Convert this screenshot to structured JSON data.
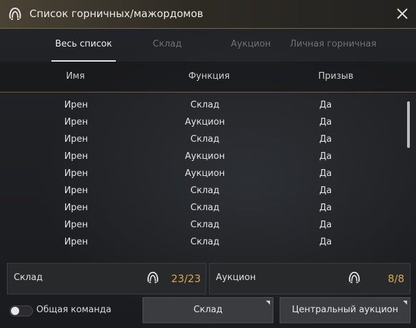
{
  "window": {
    "title": "Список горничных/мажордомов"
  },
  "tabs": [
    {
      "label": "Весь список",
      "active": true
    },
    {
      "label": "Склад",
      "active": false
    },
    {
      "label": "Аукцион",
      "active": false
    },
    {
      "label": "Личная горничная",
      "active": false
    }
  ],
  "table": {
    "columns": [
      "Имя",
      "Функция",
      "Призыв"
    ],
    "rows": [
      [
        "Ирен",
        "Склад",
        "Да"
      ],
      [
        "Ирен",
        "Аукцион",
        "Да"
      ],
      [
        "Ирен",
        "Склад",
        "Да"
      ],
      [
        "Ирен",
        "Аукцион",
        "Да"
      ],
      [
        "Ирен",
        "Аукцион",
        "Да"
      ],
      [
        "Ирен",
        "Склад",
        "Да"
      ],
      [
        "Ирен",
        "Склад",
        "Да"
      ],
      [
        "Ирен",
        "Склад",
        "Да"
      ],
      [
        "Ирен",
        "Склад",
        "Да"
      ]
    ]
  },
  "summary": {
    "warehouse": {
      "label": "Склад",
      "count": "23/23",
      "icon": "maid-icon"
    },
    "auction": {
      "label": "Аукцион",
      "count": "8/8",
      "icon": "maid-icon"
    }
  },
  "footer": {
    "toggle_label": "Общая команда",
    "toggle_on": false,
    "warehouse_button": "Склад",
    "auction_button": "Центральный аукцион"
  },
  "colors": {
    "accent_gold": "#d9a94a",
    "title_border": "#7a6a48"
  }
}
